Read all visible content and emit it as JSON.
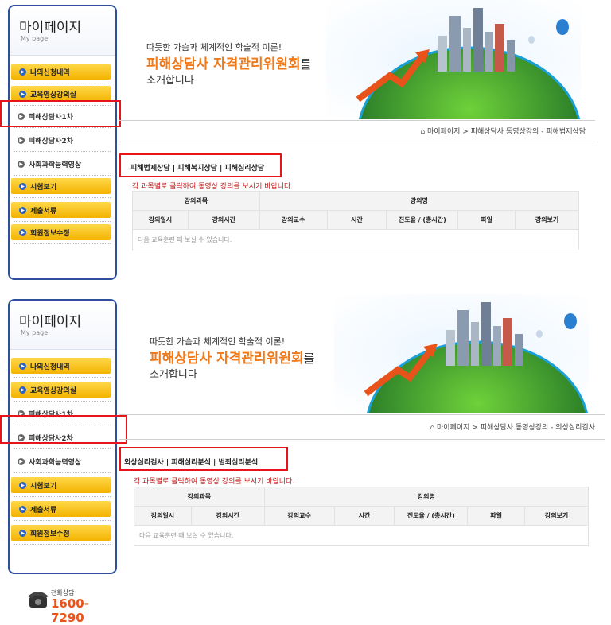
{
  "panels": [
    {
      "mypage": {
        "title": "마이페이지",
        "subtitle": "My page"
      },
      "menu": [
        "나의신청내역",
        "교육영상강의실",
        "피해상담사1차",
        "피해상담사2차",
        "사회과학능력영상",
        "시험보기",
        "제출서류",
        "회원정보수정"
      ],
      "banner": {
        "line1": "따듯한 가슴과 체계적인 학술적 이론!",
        "line2": "피해상담사 자격관리위원회",
        "line2_suffix": "를",
        "line3": "소개합니다"
      },
      "breadcrumb": "마이페이지 > 피해상담사 동영상강의 - 피해법제상담",
      "subtabs": "피해법제상담 | 피해복지상담 | 피해심리상담",
      "notice": "각 과목별로 클릭하여 동영상 강의를 보시기 바랍니다.",
      "table": {
        "group1": "강의과목",
        "group2": "강의명",
        "cols": [
          "강의일시",
          "강의시간",
          "강의교수",
          "시간",
          "진도율 / (총시간)",
          "파일",
          "강의보기"
        ],
        "empty": "다음 교육훈련 때 보실 수 있습니다."
      }
    },
    {
      "mypage": {
        "title": "마이페이지",
        "subtitle": "My page"
      },
      "menu": [
        "나의신청내역",
        "교육영상강의실",
        "피해상담사1차",
        "피해상담사2차",
        "사회과학능력영상",
        "시험보기",
        "제출서류",
        "회원정보수정"
      ],
      "banner": {
        "line1": "따듯한 가슴과 체계적인 학술적 이론!",
        "line2": "피해상담사 자격관리위원회",
        "line2_suffix": "를",
        "line3": "소개합니다"
      },
      "breadcrumb": "마이페이지 > 피해상담사 동영상강의 - 외상심리검사",
      "subtabs": "외상심리검사 | 피해심리분석 | 범죄심리분석",
      "notice": "각 과목별로 클릭하여 동영상 강의를 보시기 바랍니다.",
      "table": {
        "group1": "강의과목",
        "group2": "강의명",
        "cols": [
          "강의일시",
          "강의시간",
          "강의교수",
          "시간",
          "진도율 / (총시간)",
          "파일",
          "강의보기"
        ],
        "empty": "다음 교육훈련 때 보실 수 있습니다."
      }
    }
  ],
  "phone": {
    "label": "전화상담",
    "number": "1600-7290"
  },
  "colors": {
    "sidebar_border": "#2e4f9c",
    "highlight": "#e8141c",
    "accent": "#f07a1a",
    "menu_yellow": "#f3b300"
  }
}
